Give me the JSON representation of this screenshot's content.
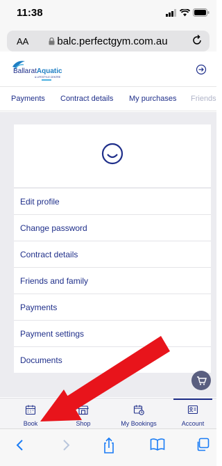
{
  "status": {
    "time": "11:38"
  },
  "url_bar": {
    "aa": "AA",
    "url": "balc.perfectgym.com.au"
  },
  "header": {
    "logo_name": "BallaratAquatic",
    "logo_prefix": "Ballarat",
    "logo_highlight": "Aquatic",
    "logo_sub": "& LIFESTYLE CENTRE"
  },
  "tabs": [
    "Payments",
    "Contract details",
    "My purchases",
    "Friends"
  ],
  "menu": [
    "Edit profile",
    "Change password",
    "Contract details",
    "Friends and family",
    "Payments",
    "Payment settings",
    "Documents"
  ],
  "bottom_nav": [
    "Book",
    "Shop",
    "My Bookings",
    "Account"
  ],
  "colors": {
    "primary": "#1f2f8a",
    "arrow": "#e8141b",
    "background": "#ececf0"
  },
  "icons": [
    "signal-icon",
    "wifi-icon",
    "battery-icon",
    "lock-icon",
    "reload-icon",
    "logout-icon",
    "avatar-icon",
    "cart-icon",
    "calendar-icon",
    "shop-icon",
    "bookings-icon",
    "account-icon",
    "back-icon",
    "forward-icon",
    "share-icon",
    "bookmarks-icon",
    "tabs-icon"
  ]
}
